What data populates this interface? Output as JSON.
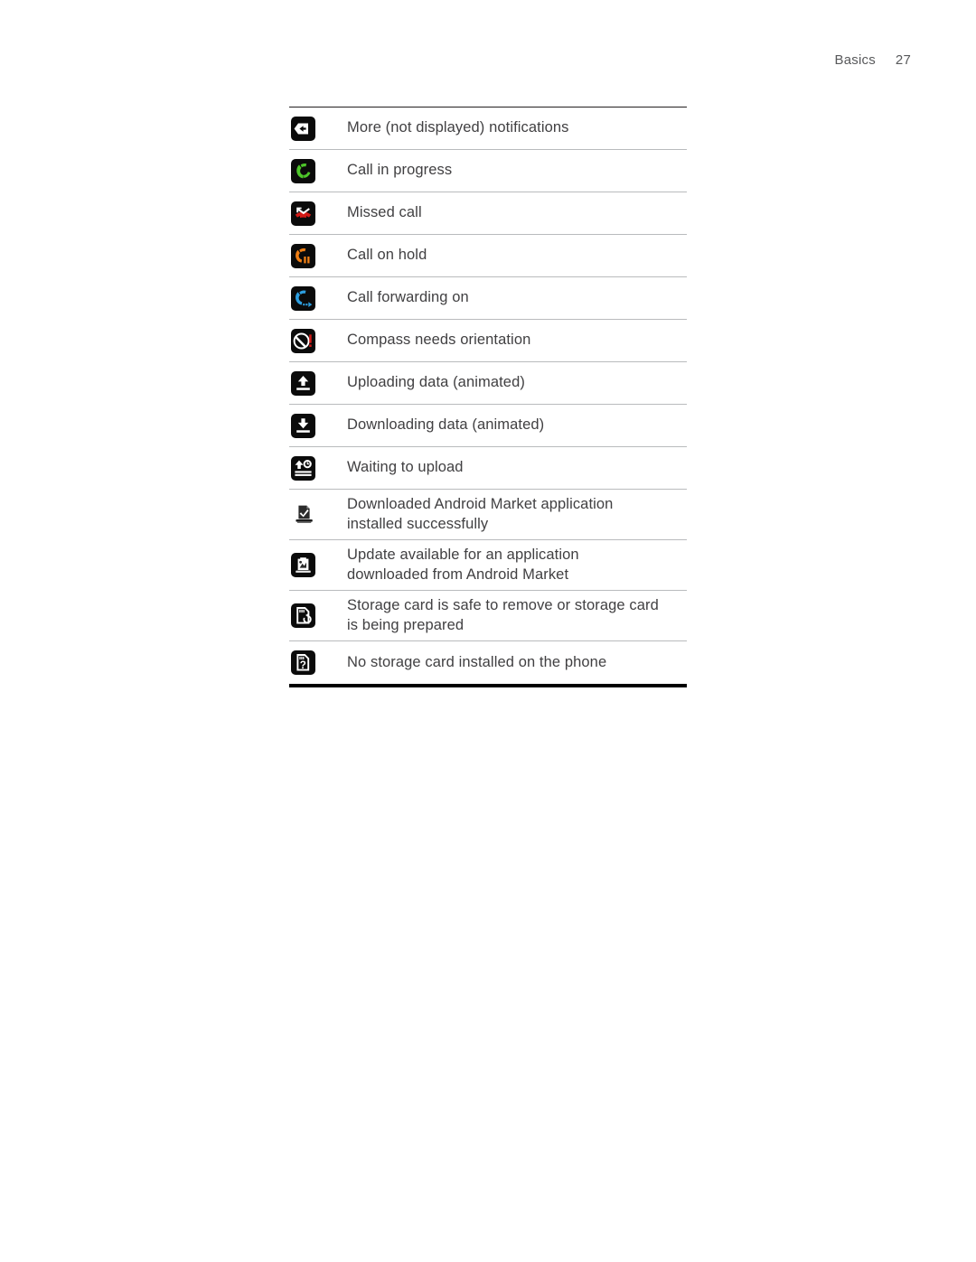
{
  "header": {
    "section": "Basics",
    "page": "27"
  },
  "table": {
    "rows": [
      {
        "icon": "more-notifications-icon",
        "lines": [
          "More (not displayed) notifications"
        ]
      },
      {
        "icon": "call-in-progress-icon",
        "lines": [
          "Call in progress"
        ]
      },
      {
        "icon": "missed-call-icon",
        "lines": [
          "Missed call"
        ]
      },
      {
        "icon": "call-on-hold-icon",
        "lines": [
          "Call on hold"
        ]
      },
      {
        "icon": "call-forwarding-icon",
        "lines": [
          "Call forwarding on"
        ]
      },
      {
        "icon": "compass-orientation-icon",
        "lines": [
          "Compass needs orientation"
        ]
      },
      {
        "icon": "upload-data-icon",
        "lines": [
          "Uploading data (animated)"
        ]
      },
      {
        "icon": "download-data-icon",
        "lines": [
          "Downloading data (animated)"
        ]
      },
      {
        "icon": "waiting-to-upload-icon",
        "lines": [
          "Waiting to upload"
        ]
      },
      {
        "icon": "app-installed-icon",
        "lines": [
          "Downloaded Android Market application",
          "installed successfully"
        ]
      },
      {
        "icon": "app-update-available-icon",
        "lines": [
          "Update available for an application",
          "downloaded from Android Market"
        ]
      },
      {
        "icon": "storage-card-safe-remove-icon",
        "lines": [
          "Storage card is safe to remove or storage card",
          "is being prepared"
        ]
      },
      {
        "icon": "no-storage-card-icon",
        "lines": [
          "No storage card installed on the phone"
        ]
      }
    ]
  },
  "colors": {
    "text": "#414042",
    "header_text": "#58595b",
    "rule_light": "#b9bbbd",
    "rule_dark": "#231f20",
    "icon_bg": "#0b0b0b",
    "green": "#4ec72a",
    "red": "#d41a16",
    "orange": "#f07f15",
    "blue": "#2e9fe0",
    "white": "#ffffff"
  }
}
